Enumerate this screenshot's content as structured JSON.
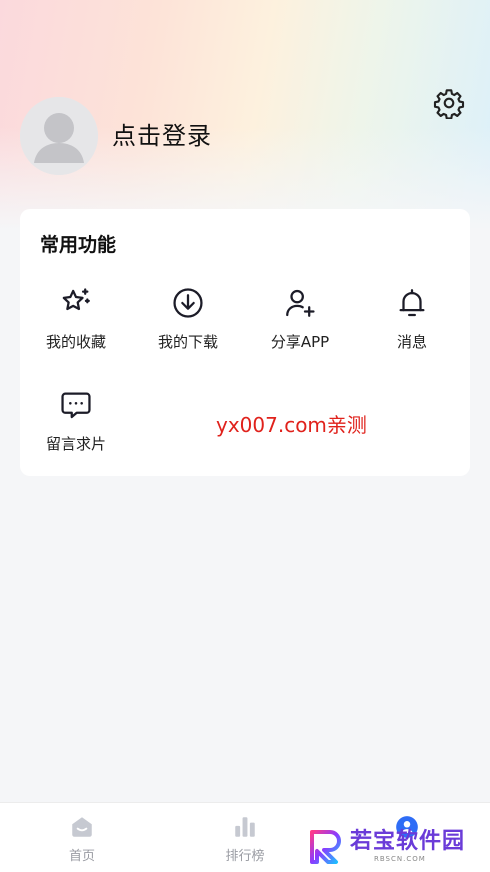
{
  "profile": {
    "login_text": "点击登录"
  },
  "functions": {
    "title": "常用功能",
    "items": [
      {
        "label": "我的收藏",
        "icon": "star-sparkle-icon"
      },
      {
        "label": "我的下载",
        "icon": "download-icon"
      },
      {
        "label": "分享APP",
        "icon": "add-user-icon"
      },
      {
        "label": "消息",
        "icon": "bell-icon"
      },
      {
        "label": "留言求片",
        "icon": "message-icon"
      }
    ]
  },
  "watermark": "yx007.com亲测",
  "tabbar": {
    "items": [
      {
        "label": "首页",
        "icon": "home-icon"
      },
      {
        "label": "排行榜",
        "icon": "bar-chart-icon"
      }
    ]
  },
  "logo": {
    "text": "若宝软件园",
    "sub": "RBSCN.COM"
  },
  "colors": {
    "accent_purple": "#6a3bd8",
    "watermark_red": "#e0221c",
    "tab_inactive": "#9a9ca3"
  }
}
